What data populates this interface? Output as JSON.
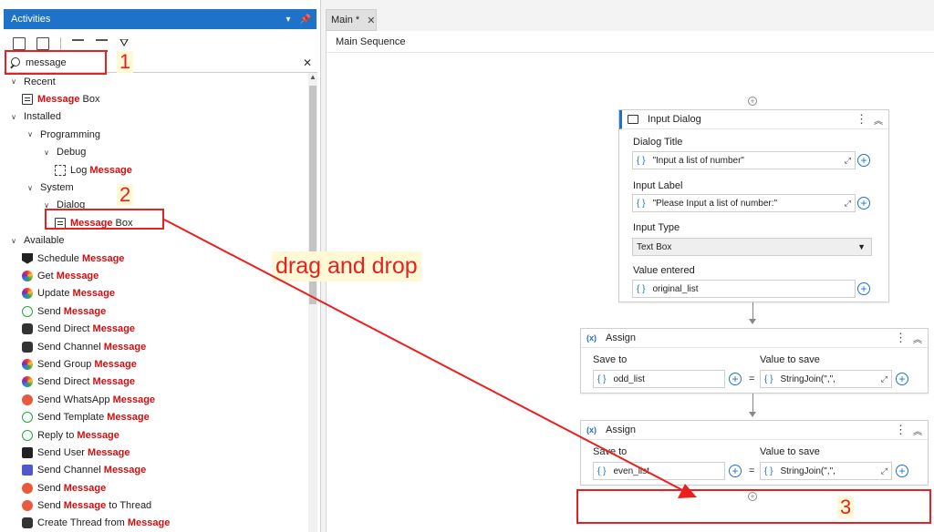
{
  "activities_panel": {
    "title": "Activities",
    "header_controls": [
      "▾",
      "⊕",
      "✕"
    ],
    "search": {
      "value": "message"
    },
    "tree": [
      {
        "kind": "group",
        "label": "Recent",
        "level": 0
      },
      {
        "kind": "item",
        "icon": "box",
        "pre": "",
        "bold": "Message",
        "post": " Box",
        "level": 1
      },
      {
        "kind": "group",
        "label": "Installed",
        "level": 0
      },
      {
        "kind": "group",
        "label": "Programming",
        "level": 1
      },
      {
        "kind": "group",
        "label": "Debug",
        "level": 2
      },
      {
        "kind": "item",
        "icon": "log",
        "pre": "Log ",
        "bold": "Message",
        "post": "",
        "level": 3
      },
      {
        "kind": "group",
        "label": "System",
        "level": 1
      },
      {
        "kind": "group",
        "label": "Dialog",
        "level": 2
      },
      {
        "kind": "item",
        "icon": "box",
        "pre": "",
        "bold": "Message",
        "post": " Box",
        "level": 3
      },
      {
        "kind": "group",
        "label": "Available",
        "level": 0
      },
      {
        "kind": "item",
        "icon": "tag",
        "pre": "Schedule ",
        "bold": "Message",
        "post": "",
        "level": 1
      },
      {
        "kind": "item",
        "icon": "circle-multi",
        "pre": "Get ",
        "bold": "Message",
        "post": "",
        "level": 1
      },
      {
        "kind": "item",
        "icon": "circle-multi",
        "pre": "Update ",
        "bold": "Message",
        "post": "",
        "level": 1
      },
      {
        "kind": "item",
        "icon": "wa",
        "pre": "Send ",
        "bold": "Message",
        "post": "",
        "level": 1
      },
      {
        "kind": "item",
        "icon": "discord",
        "pre": "Send Direct ",
        "bold": "Message",
        "post": "",
        "level": 1
      },
      {
        "kind": "item",
        "icon": "discord",
        "pre": "Send Channel ",
        "bold": "Message",
        "post": "",
        "level": 1
      },
      {
        "kind": "item",
        "icon": "circle-multi",
        "pre": "Send Group ",
        "bold": "Message",
        "post": "",
        "level": 1
      },
      {
        "kind": "item",
        "icon": "circle-multi",
        "pre": "Send Direct ",
        "bold": "Message",
        "post": "",
        "level": 1
      },
      {
        "kind": "item",
        "icon": "red",
        "pre": "Send WhatsApp ",
        "bold": "Message",
        "post": "",
        "level": 1
      },
      {
        "kind": "item",
        "icon": "wa",
        "pre": "Send Template ",
        "bold": "Message",
        "post": "",
        "level": 1
      },
      {
        "kind": "item",
        "icon": "wa",
        "pre": "Reply to ",
        "bold": "Message",
        "post": "",
        "level": 1
      },
      {
        "kind": "item",
        "icon": "dark",
        "pre": "Send User ",
        "bold": "Message",
        "post": "",
        "level": 1
      },
      {
        "kind": "item",
        "icon": "teams",
        "pre": "Send Channel ",
        "bold": "Message",
        "post": "",
        "level": 1
      },
      {
        "kind": "item",
        "icon": "red",
        "pre": "Send ",
        "bold": "Message",
        "post": "",
        "level": 1
      },
      {
        "kind": "item",
        "icon": "red",
        "pre": "Send ",
        "bold": "Message",
        "post": " to Thread",
        "level": 1
      },
      {
        "kind": "item",
        "icon": "discord",
        "pre": "Create Thread from ",
        "bold": "Message",
        "post": "",
        "level": 1
      }
    ]
  },
  "designer": {
    "tab_label": "Main *",
    "tab_close": "✕",
    "breadcrumb": "Main Sequence",
    "input_dialog": {
      "title": "Input Dialog",
      "dialog_title_label": "Dialog Title",
      "dialog_title_value": "\"Input a list of number\"",
      "input_label_label": "Input Label",
      "input_label_value": "\"Please Input a list of number:\"",
      "input_type_label": "Input Type",
      "input_type_value": "Text Box",
      "value_entered_label": "Value entered",
      "value_entered_value": "original_list"
    },
    "assign1": {
      "title": "Assign",
      "save_to_label": "Save to",
      "save_to_value": "odd_list",
      "value_label": "Value to save",
      "value_value": "StringJoin(\",\","
    },
    "assign2": {
      "title": "Assign",
      "save_to_label": "Save to",
      "save_to_value": "even_list",
      "value_label": "Value to save",
      "value_value": "StringJoin(\",\","
    }
  },
  "annotations": {
    "step1": "1",
    "step2": "2",
    "step3": "3",
    "drag_text": "drag and drop",
    "color": "#e82020"
  }
}
